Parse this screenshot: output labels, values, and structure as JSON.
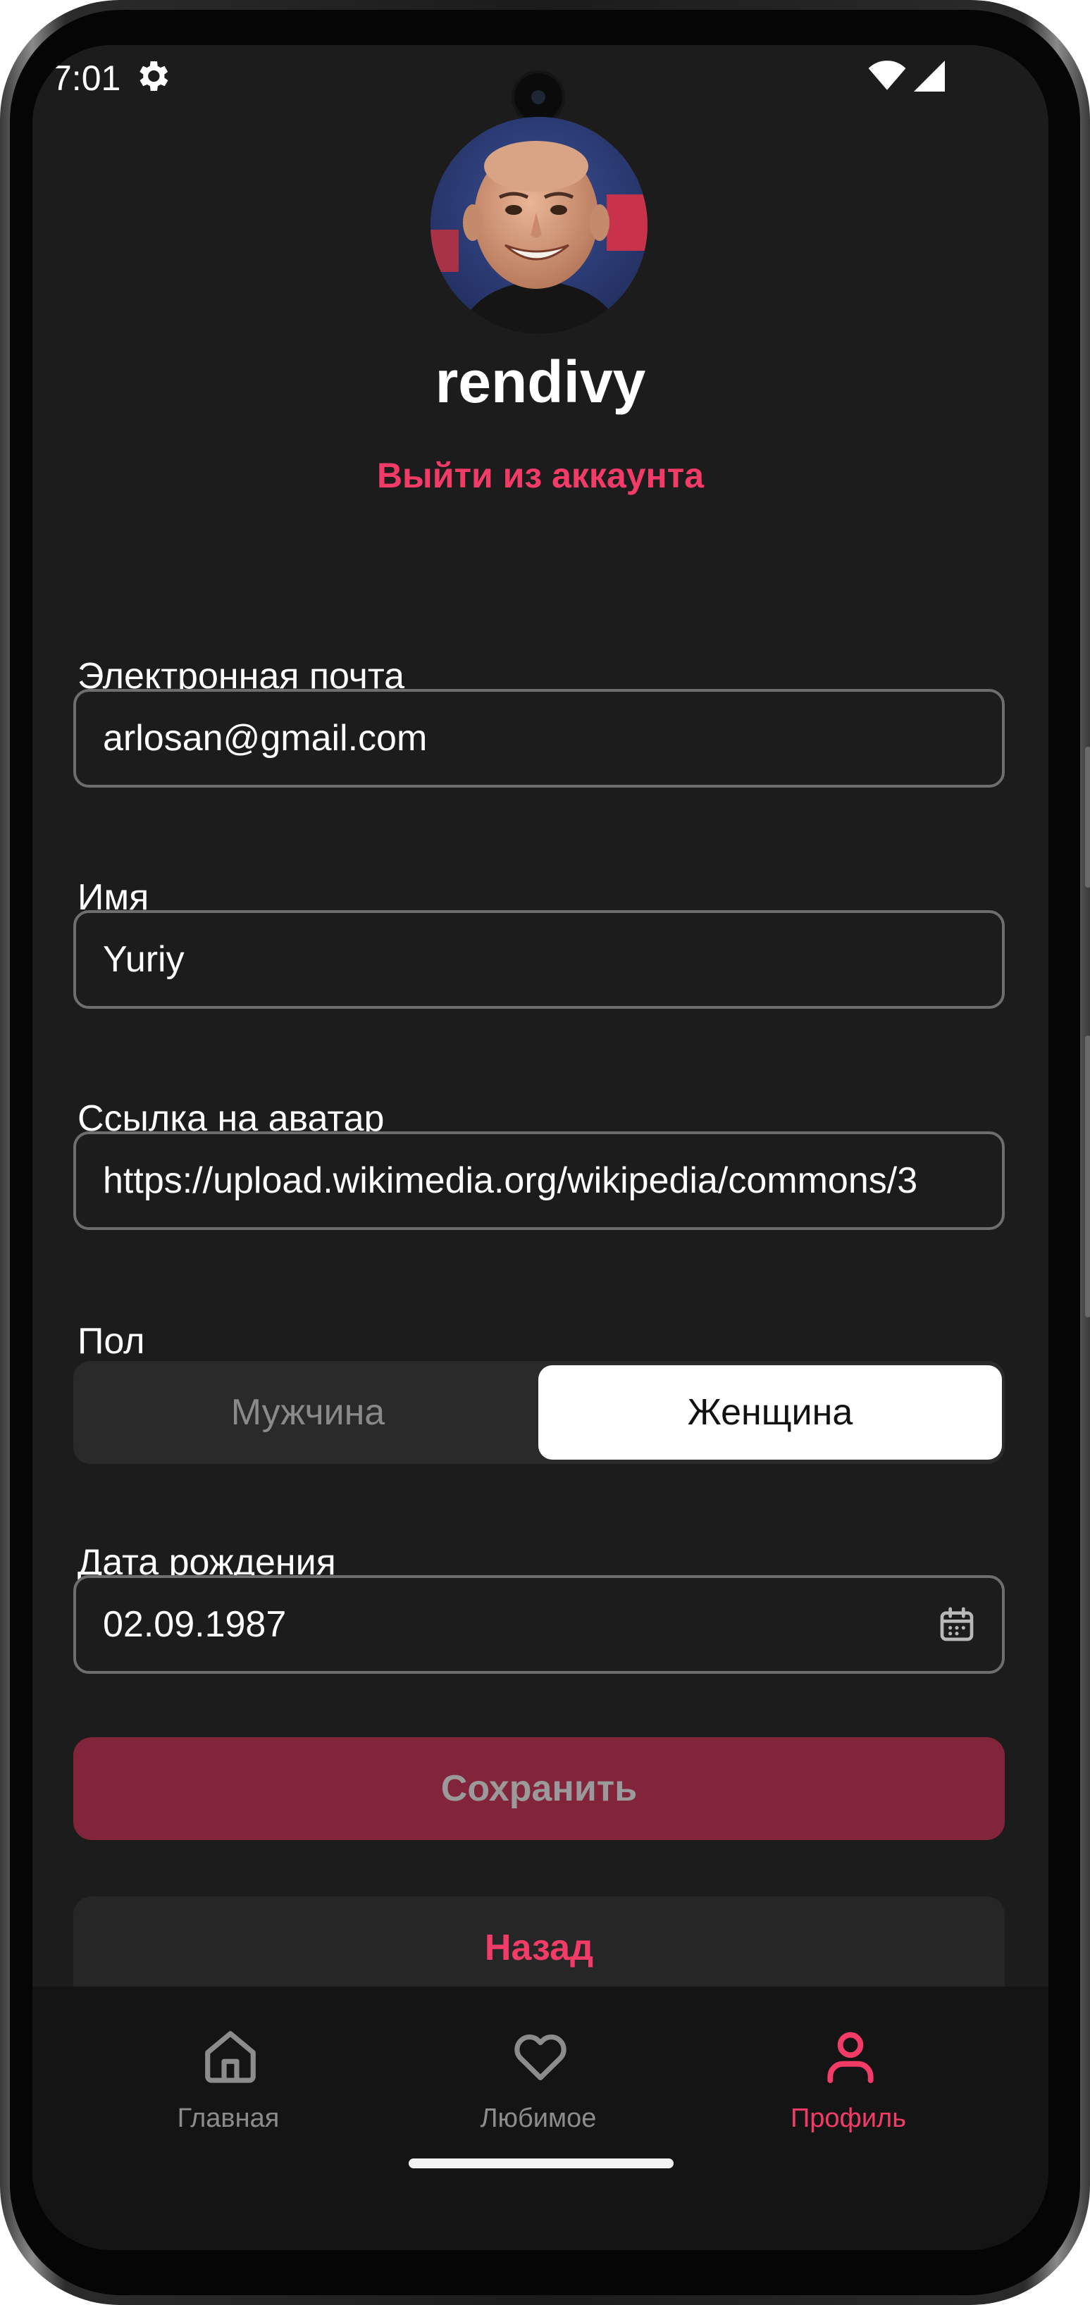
{
  "status_bar": {
    "time": "7:01",
    "settings_icon": "gear-icon",
    "wifi_icon": "wifi-icon",
    "signal_icon": "signal-icon"
  },
  "profile": {
    "avatar": "avatar-photo",
    "username": "rendivy",
    "logout_label": "Выйти из аккаунта"
  },
  "form": {
    "email": {
      "label": "Электронная почта",
      "value": "arlosan@gmail.com"
    },
    "name": {
      "label": "Имя",
      "value": "Yuriy"
    },
    "avatar_link": {
      "label": "Ссылка на аватар",
      "value": "https://upload.wikimedia.org/wikipedia/commons/3"
    },
    "gender": {
      "label": "Пол",
      "options": [
        "Мужчина",
        "Женщина"
      ],
      "selected": "Женщина"
    },
    "birthdate": {
      "label": "Дата рождения",
      "value": "02.09.1987",
      "icon": "calendar-icon"
    }
  },
  "actions": {
    "save_label": "Сохранить",
    "back_label": "Назад"
  },
  "bottom_nav": {
    "items": [
      {
        "label": "Главная",
        "icon": "home-icon",
        "active": false
      },
      {
        "label": "Любимое",
        "icon": "heart-icon",
        "active": false
      },
      {
        "label": "Профиль",
        "icon": "person-icon",
        "active": true
      }
    ]
  },
  "colors": {
    "accent": "#f23b66",
    "background": "#1c1c1c",
    "save_button": "#82243a",
    "nav_background": "#141414"
  }
}
